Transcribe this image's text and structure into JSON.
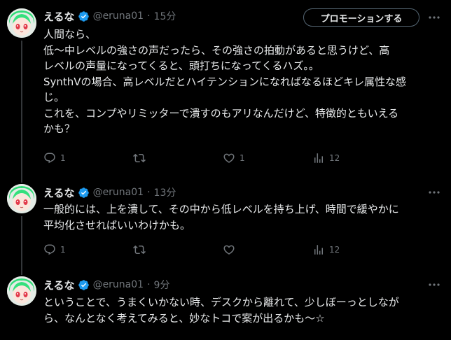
{
  "tweets": [
    {
      "name": "えるな",
      "handle": "@eruna01",
      "separator": "·",
      "time": "15分",
      "promo_label": "プロモーションする",
      "lines": [
        "人間なら、",
        "低〜中レベルの強さの声だったら、その強さの拍動があると思うけど、高",
        "レベルの声量になってくると、頭打ちになってくるハズ。。",
        "SynthVの場合、高レベルだとハイテンションになればなるほどキレ属性な感",
        "じ。",
        "これを、コンプやリミッターで潰すのもアリなんだけど、特徴的ともいえる",
        "かも？"
      ],
      "reply_count": "1",
      "retweet_count": "",
      "like_count": "1",
      "view_count": "12"
    },
    {
      "name": "えるな",
      "handle": "@eruna01",
      "separator": "·",
      "time": "13分",
      "lines": [
        "一般的には、上を潰して、その中から低レベルを持ち上げ、時間で緩やかに",
        "平均化させればいいわけかも。"
      ],
      "reply_count": "1",
      "retweet_count": "",
      "like_count": "",
      "view_count": "12"
    },
    {
      "name": "えるな",
      "handle": "@eruna01",
      "separator": "·",
      "time": "9分",
      "lines": [
        "ということで、うまくいかない時、デスクから離れて、少しぼーっとしなが",
        "ら、なんとなく考えてみると、妙なトコで案が出るかも〜☆"
      ]
    }
  ],
  "colors": {
    "background": "#000000",
    "text": "#e7e9ea",
    "secondary": "#71767b",
    "verified": "#1d9bf0",
    "thread_line": "#333639"
  },
  "icons": [
    "verified-badge-icon",
    "more-icon",
    "reply-icon",
    "retweet-icon",
    "like-icon",
    "views-icon",
    "avatar"
  ]
}
